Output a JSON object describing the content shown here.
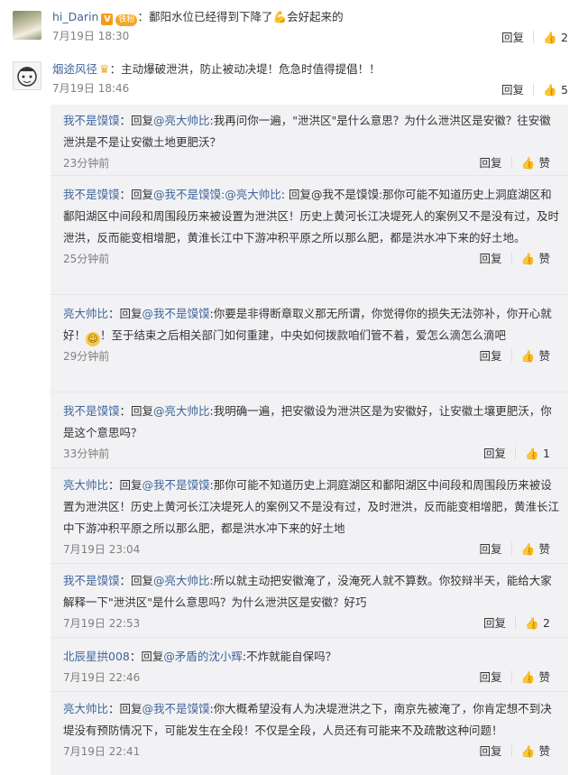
{
  "top_comments": [
    {
      "username": "hi_Darin",
      "badge_v": "V",
      "badge_fan": "铁粉",
      "text_before": "：鄱阳水位已经得到下降了",
      "emoji": "💪",
      "text_after": "会好起来的",
      "time": "7月19日 18:30",
      "reply_label": "回复",
      "likes": "2"
    },
    {
      "username": "烟途风径",
      "crown": "♛",
      "text": "：主动爆破泄洪，防止被动决堤！危急时值得提倡！！",
      "time": "7月19日 18:46",
      "reply_label": "回复",
      "likes": "5"
    }
  ],
  "replies": [
    {
      "user": "我不是馍馍",
      "reply_word": "：回复",
      "mention1": "@亮大帅比",
      "mention2": "",
      "text": ":我再问你一遍，\"泄洪区\"是什么意思？为什么泄洪区是安徽？往安徽泄洪是不是让安徽土地更肥沃？",
      "time": "23分钟前",
      "reply_label": "回复",
      "likes": "赞"
    },
    {
      "user": "我不是馍馍",
      "reply_word": "：回复",
      "mention1": "@我不是馍馍",
      "mention2": "@亮大帅比",
      "text": ": 回复@我不是馍馍:那你可能不知道历史上洞庭湖区和鄱阳湖区中间段和周围段历来被设置为泄洪区！历史上黄河长江决堤死人的案例又不是没有过，及时泄洪，反而能变相增肥，黄淮长江中下游冲积平原之所以那么肥，都是洪水冲下来的好土地。",
      "time": "25分钟前",
      "reply_label": "回复",
      "likes": "赞"
    },
    {
      "user": "亮大帅比",
      "reply_word": "：回复",
      "mention1": "@我不是馍馍",
      "mention2": "",
      "text": ":你要是非得断章取义那无所谓，你觉得你的损失无法弥补，你开心就好！",
      "text2": "！至于结束之后相关部门如何重建，中央如何拨款咱们管不着，爱怎么滴怎么滴吧",
      "time": "29分钟前",
      "reply_label": "回复",
      "likes": "赞"
    },
    {
      "user": "我不是馍馍",
      "reply_word": "：回复",
      "mention1": "@亮大帅比",
      "mention2": "",
      "text": ":我明确一遍，把安徽设为泄洪区是为安徽好，让安徽土壤更肥沃，你是这个意思吗？",
      "time": "33分钟前",
      "reply_label": "回复",
      "likes": "1"
    },
    {
      "user": "亮大帅比",
      "reply_word": "：回复",
      "mention1": "@我不是馍馍",
      "mention2": "",
      "text": ":那你可能不知道历史上洞庭湖区和鄱阳湖区中间段和周围段历来被设置为泄洪区！历史上黄河长江决堤死人的案例又不是没有过，及时泄洪，反而能变相增肥，黄淮长江中下游冲积平原之所以那么肥，都是洪水冲下来的好土地",
      "time": "7月19日 23:04",
      "reply_label": "回复",
      "likes": "赞"
    },
    {
      "user": "我不是馍馍",
      "reply_word": "：回复",
      "mention1": "@亮大帅比",
      "mention2": "",
      "text": ":所以就主动把安徽淹了，没淹死人就不算数。你狡辩半天，能给大家解释一下\"泄洪区\"是什么意思吗？为什么泄洪区是安徽？好巧",
      "time": "7月19日 22:53",
      "reply_label": "回复",
      "likes": "2"
    },
    {
      "user": "北辰星拱008",
      "reply_word": "：回复",
      "mention1": "@矛盾的沈小辉",
      "mention2": "",
      "text": ":不炸就能自保吗？",
      "time": "7月19日 22:46",
      "reply_label": "回复",
      "likes": "赞"
    },
    {
      "user": "亮大帅比",
      "reply_word": "：回复",
      "mention1": "@我不是馍馍",
      "mention2": "",
      "text": ":你大概希望没有人为决堤泄洪之下，南京先被淹了，你肯定想不到决堤没有预防情况下，可能发生在全段！不仅是全段，人员还有可能来不及疏散这种问题！",
      "time": "7月19日 22:41",
      "reply_label": "回复",
      "likes": "赞"
    }
  ]
}
